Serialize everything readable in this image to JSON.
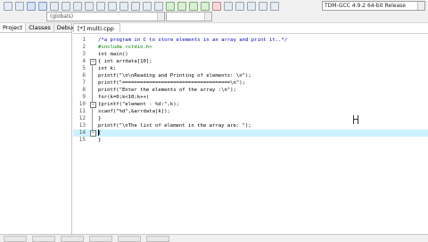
{
  "toolbar": {
    "compiler_select": "TDM-GCC 4.9.2 64-bit Release",
    "scope_select": "(globals)",
    "symbol_select": ""
  },
  "left_panel": {
    "tabs": [
      "Project",
      "Classes",
      "Debug"
    ],
    "active_tab": "Project"
  },
  "editor": {
    "file_tab": "[*] multi.cpp",
    "current_line": 14,
    "lines": [
      {
        "n": "1",
        "text": "/*a program in C to store elements in an array and print it..*/"
      },
      {
        "n": "2",
        "text": "#include <stdio.h>"
      },
      {
        "n": "3",
        "text": "int main()"
      },
      {
        "n": "4",
        "text": "{ int arrdata[10];"
      },
      {
        "n": "5",
        "text": "int k;"
      },
      {
        "n": "6",
        "text": "printf(\"\\n\\nReading and Printing of elements: \\n\");"
      },
      {
        "n": "7",
        "text": "printf(\"====================================\\n\");"
      },
      {
        "n": "8",
        "text": "printf(\"Enter the elements of the array :\\n\");"
      },
      {
        "n": "9",
        "text": "for(k=0;k<10;k++)"
      },
      {
        "n": "10",
        "text": "{printf(\"element - %d:\",k);"
      },
      {
        "n": "11",
        "text": "scanf(\"%d\",&arrdata[k]);"
      },
      {
        "n": "12",
        "text": "}"
      },
      {
        "n": "13",
        "text": "printf(\"\\nThe list of element in the array are: \");"
      },
      {
        "n": "14",
        "text": "{"
      },
      {
        "n": "15",
        "text": "}"
      }
    ]
  }
}
